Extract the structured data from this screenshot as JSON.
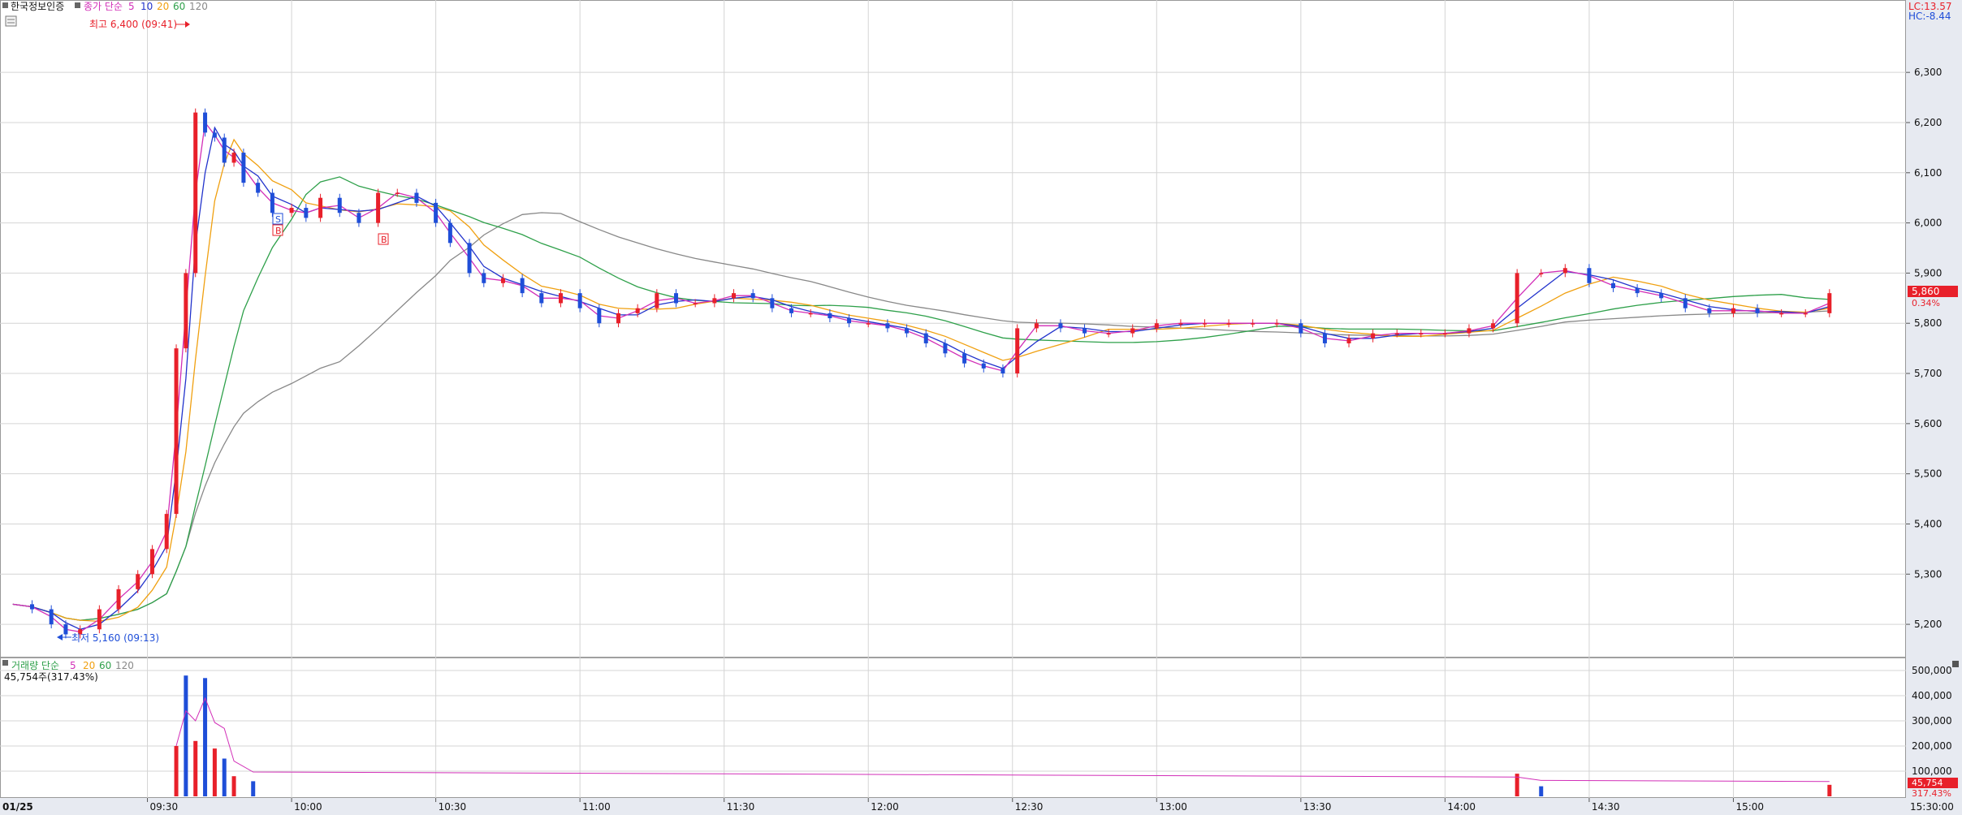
{
  "stock_name": "한국정보인증",
  "price_legend": {
    "prefix": "종가 단순",
    "periods": [
      "5",
      "10",
      "20",
      "60",
      "120"
    ]
  },
  "volume_legend": {
    "prefix": "거래량 단순",
    "periods": [
      "5",
      "20",
      "60",
      "120"
    ]
  },
  "volume_readout": "45,754주(317.43%)",
  "high_marker": "최고 6,400 (09:41)",
  "low_marker": "최저 5,160 (09:13)",
  "lc_label": "LC:13.57",
  "hc_label": "HC:-8.44",
  "current_price": "5,860",
  "current_change": "0.34%",
  "current_volume": "45,754",
  "current_volume_pct": "317.43%",
  "date_label": "01/25",
  "end_time": "15:30:00",
  "signal_labels": [
    "S",
    "B",
    "B"
  ],
  "colors": {
    "up": "#e8202a",
    "down": "#1f4ed8",
    "ma5": "#d22fb8",
    "ma10": "#2233cc",
    "ma20": "#f0a010",
    "ma60": "#2ea04a",
    "ma120": "#888888",
    "grid": "#d4d4d4",
    "axis_bg": "#e7eaf1"
  },
  "chart_data": [
    {
      "type": "candlestick",
      "x_ticks": [
        "09:30",
        "10:00",
        "10:30",
        "11:00",
        "11:30",
        "12:00",
        "12:30",
        "13:00",
        "13:30",
        "14:00",
        "14:30",
        "15:00"
      ],
      "y_ticks": [
        "6,300",
        "6,200",
        "6,100",
        "6,000",
        "5,900",
        "5,800",
        "5,700",
        "5,600",
        "5,500",
        "5,400",
        "5,300",
        "5,200"
      ],
      "ylim": [
        5150,
        6420
      ],
      "series": [
        {
          "name": "종가",
          "points": [
            [
              "09:02",
              5240
            ],
            [
              "09:06",
              5230
            ],
            [
              "09:10",
              5200
            ],
            [
              "09:13",
              5180
            ],
            [
              "09:16",
              5190
            ],
            [
              "09:20",
              5230
            ],
            [
              "09:24",
              5270
            ],
            [
              "09:28",
              5300
            ],
            [
              "09:31",
              5350
            ],
            [
              "09:34",
              5420
            ],
            [
              "09:36",
              5750
            ],
            [
              "09:38",
              5900
            ],
            [
              "09:40",
              6220
            ],
            [
              "09:42",
              6180
            ],
            [
              "09:44",
              6170
            ],
            [
              "09:46",
              6120
            ],
            [
              "09:48",
              6140
            ],
            [
              "09:50",
              6080
            ],
            [
              "09:53",
              6060
            ],
            [
              "09:56",
              6020
            ],
            [
              "10:00",
              6030
            ],
            [
              "10:03",
              6010
            ],
            [
              "10:06",
              6050
            ],
            [
              "10:10",
              6020
            ],
            [
              "10:14",
              6000
            ],
            [
              "10:18",
              6060
            ],
            [
              "10:22",
              6060
            ],
            [
              "10:26",
              6040
            ],
            [
              "10:30",
              6000
            ],
            [
              "10:33",
              5960
            ],
            [
              "10:37",
              5900
            ],
            [
              "10:40",
              5880
            ],
            [
              "10:44",
              5890
            ],
            [
              "10:48",
              5860
            ],
            [
              "10:52",
              5840
            ],
            [
              "10:56",
              5860
            ],
            [
              "11:00",
              5830
            ],
            [
              "11:04",
              5800
            ],
            [
              "11:08",
              5820
            ],
            [
              "11:12",
              5830
            ],
            [
              "11:16",
              5860
            ],
            [
              "11:20",
              5840
            ],
            [
              "11:24",
              5840
            ],
            [
              "11:28",
              5850
            ],
            [
              "11:32",
              5860
            ],
            [
              "11:36",
              5850
            ],
            [
              "11:40",
              5830
            ],
            [
              "11:44",
              5820
            ],
            [
              "11:48",
              5820
            ],
            [
              "11:52",
              5810
            ],
            [
              "11:56",
              5800
            ],
            [
              "12:00",
              5800
            ],
            [
              "12:04",
              5790
            ],
            [
              "12:08",
              5780
            ],
            [
              "12:12",
              5760
            ],
            [
              "12:16",
              5740
            ],
            [
              "12:20",
              5720
            ],
            [
              "12:24",
              5710
            ],
            [
              "12:28",
              5700
            ],
            [
              "12:31",
              5790
            ],
            [
              "12:35",
              5800
            ],
            [
              "12:40",
              5790
            ],
            [
              "12:45",
              5780
            ],
            [
              "12:50",
              5780
            ],
            [
              "12:55",
              5790
            ],
            [
              "13:00",
              5800
            ],
            [
              "13:05",
              5800
            ],
            [
              "13:10",
              5800
            ],
            [
              "13:15",
              5800
            ],
            [
              "13:20",
              5800
            ],
            [
              "13:25",
              5800
            ],
            [
              "13:30",
              5780
            ],
            [
              "13:35",
              5760
            ],
            [
              "13:40",
              5770
            ],
            [
              "13:45",
              5780
            ],
            [
              "13:50",
              5780
            ],
            [
              "13:55",
              5780
            ],
            [
              "14:00",
              5780
            ],
            [
              "14:05",
              5790
            ],
            [
              "14:10",
              5800
            ],
            [
              "14:15",
              5900
            ],
            [
              "14:20",
              5900
            ],
            [
              "14:25",
              5910
            ],
            [
              "14:30",
              5880
            ],
            [
              "14:35",
              5870
            ],
            [
              "14:40",
              5860
            ],
            [
              "14:45",
              5850
            ],
            [
              "14:50",
              5830
            ],
            [
              "14:55",
              5820
            ],
            [
              "15:00",
              5830
            ],
            [
              "15:05",
              5820
            ],
            [
              "15:10",
              5820
            ],
            [
              "15:15",
              5820
            ],
            [
              "15:20",
              5860
            ]
          ]
        }
      ]
    },
    {
      "type": "bar",
      "y_ticks": [
        "500,000",
        "400,000",
        "300,000",
        "200,000",
        "100,000"
      ],
      "ylim": [
        0,
        500000
      ],
      "series": [
        {
          "name": "거래량",
          "points": [
            [
              "09:36",
              200000
            ],
            [
              "09:38",
              480000
            ],
            [
              "09:40",
              220000
            ],
            [
              "09:42",
              470000
            ],
            [
              "09:44",
              190000
            ],
            [
              "09:46",
              150000
            ],
            [
              "09:48",
              80000
            ],
            [
              "09:52",
              60000
            ],
            [
              "14:15",
              90000
            ],
            [
              "14:20",
              40000
            ],
            [
              "15:20",
              45754
            ]
          ]
        }
      ]
    }
  ]
}
